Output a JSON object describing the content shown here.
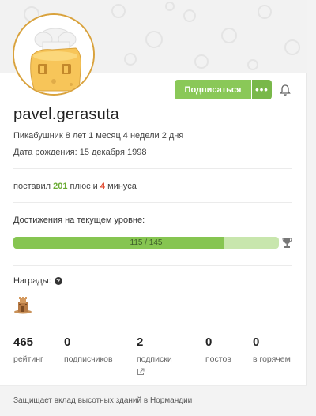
{
  "profile": {
    "username": "pavel.gerasuta",
    "tenure": "Пикабушник 8 лет 1 месяц 4 недели 2 дня",
    "birthday": "Дата рождения: 15 декабря 1998",
    "subscribe_label": "Подписаться",
    "more_label": "•••"
  },
  "votes": {
    "prefix": "поставил ",
    "plus_count": "201",
    "middle": " плюс и ",
    "minus_count": "4",
    "suffix": " минуса"
  },
  "achievements": {
    "title": "Достижения на текущем уровне:",
    "progress_text": "115 / 145",
    "current": 115,
    "total": 145
  },
  "awards": {
    "title": "Награды:"
  },
  "stats": [
    {
      "value": "465",
      "label": "рейтинг"
    },
    {
      "value": "0",
      "label": "подписчиков"
    },
    {
      "value": "2",
      "label": "подписки"
    },
    {
      "value": "0",
      "label": "постов"
    },
    {
      "value": "0",
      "label": "в горячем"
    }
  ],
  "footer": {
    "text": "Защищает вклад высотных зданий в Нормандии"
  },
  "colors": {
    "accent_green": "#8ac858",
    "plus_green": "#6aab34",
    "minus_red": "#e0452b",
    "avatar_border": "#d9a23c"
  },
  "icons": {
    "bell": "bell-icon",
    "help": "question-circle-icon",
    "cup": "trophy-icon",
    "external": "external-link-icon",
    "award": "castle-award-icon"
  }
}
